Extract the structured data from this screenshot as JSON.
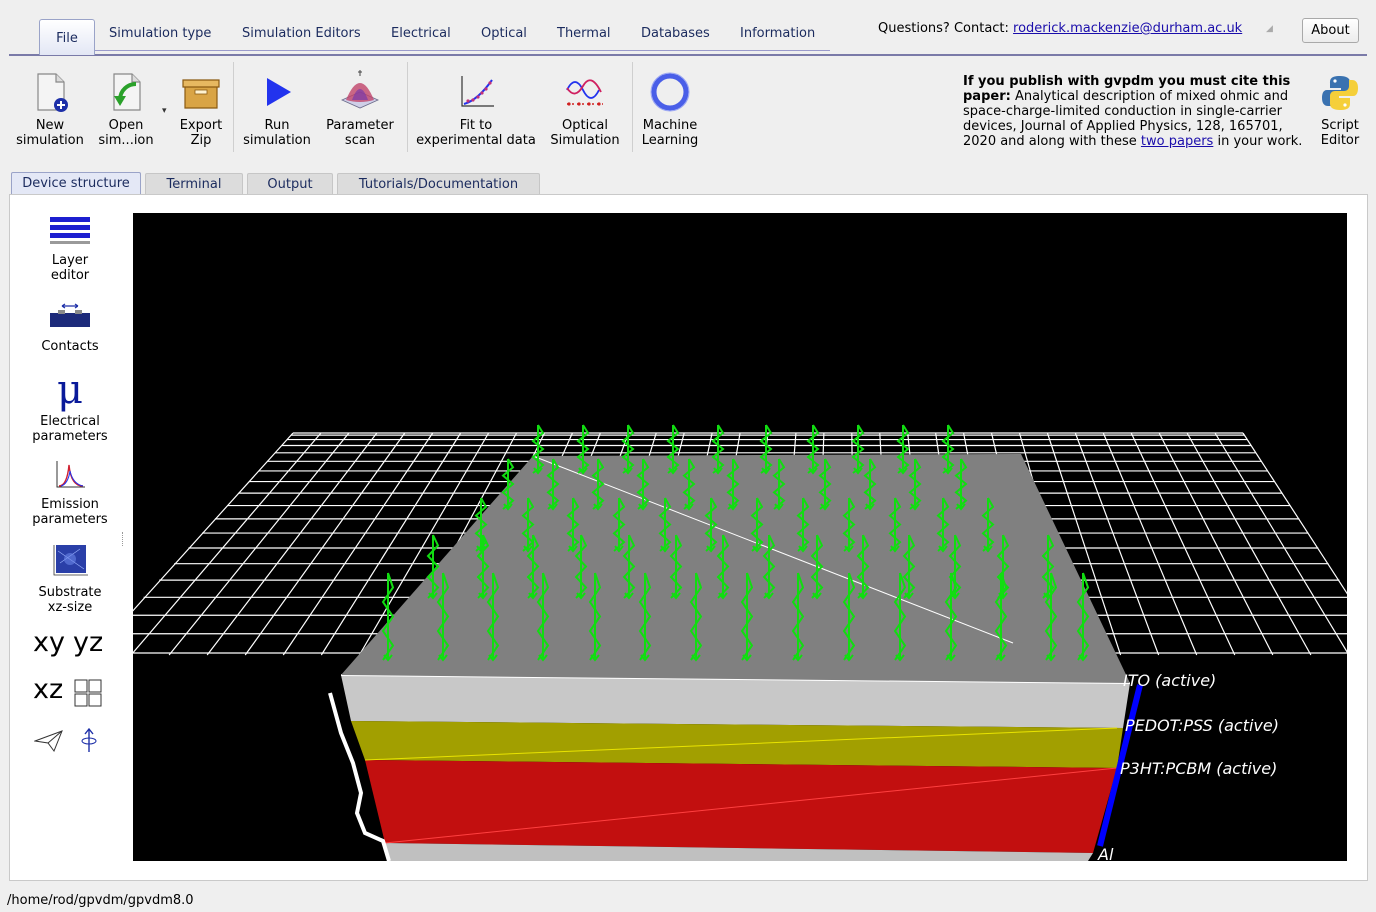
{
  "menu": {
    "tabs": [
      "File",
      "Simulation type",
      "Simulation Editors",
      "Electrical",
      "Optical",
      "Thermal",
      "Databases",
      "Information"
    ],
    "contact_prefix": "Questions? Contact: ",
    "contact_email": "roderick.mackenzie@durham.ac.uk",
    "about": "About"
  },
  "toolbar": {
    "new_simulation": "New\nsimulation",
    "open_simulation": "Open\nsim...ion",
    "export_zip": "Export\nZip",
    "run_simulation": "Run\nsimulation",
    "parameter_scan": "Parameter\nscan",
    "fit_experimental": "Fit to\nexperimental data",
    "optical_simulation": "Optical\nSimulation",
    "machine_learning": "Machine\nLearning",
    "script_editor": "Script\nEditor"
  },
  "citation": {
    "bold": "If you publish with gvpdm you must cite this paper:",
    "text": " Analytical description of mixed ohmic and space-charge-limited conduction in single-carrier devices, Journal of Applied Physics, 128, 165701, 2020 and along with these ",
    "link": "two papers",
    "suffix": " in your work."
  },
  "notebook_tabs": [
    "Device structure",
    "Terminal",
    "Output",
    "Tutorials/Documentation"
  ],
  "sidebar": {
    "layer_editor": "Layer\neditor",
    "contacts": "Contacts",
    "mu_symbol": "μ",
    "electrical_parameters": "Electrical\nparameters",
    "emission_parameters": "Emission\nparameters",
    "substrate_xz_size": "Substrate\nxz-size",
    "view_xy": "xy",
    "view_yz": "yz",
    "view_xz": "xz"
  },
  "device_layers": [
    {
      "label": "ITO (active)",
      "color": "#c8c8c8"
    },
    {
      "label": "PEDOT:PSS (active)",
      "color": "#a29f00"
    },
    {
      "label": "P3HT:PCBM (active)",
      "color": "#c20f0f"
    },
    {
      "label": "Al",
      "color": "#c0c0c0"
    }
  ],
  "colors": {
    "accent": "#1b2b5e",
    "link": "#1a0dab",
    "photon_arrows": "#11dd11",
    "top_surface": "#808080",
    "contact_bar": "#0000ff"
  },
  "status_path": "/home/rod/gpvdm/gpvdm8.0"
}
